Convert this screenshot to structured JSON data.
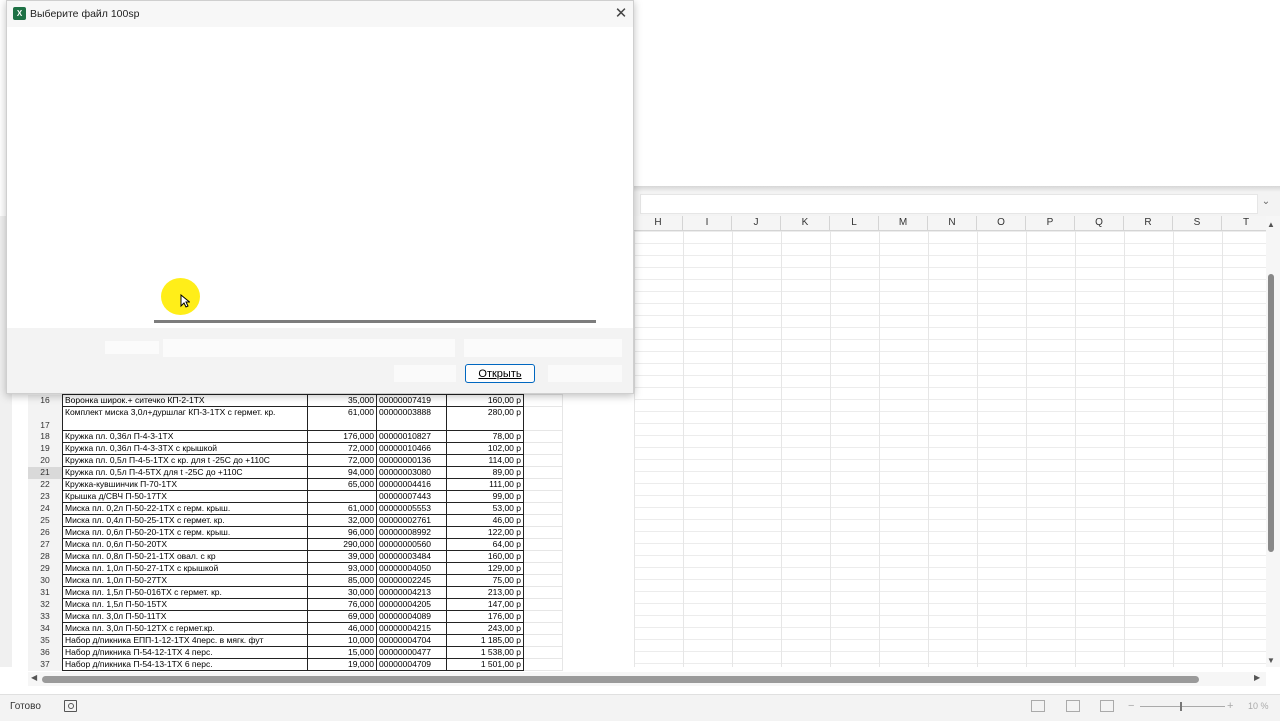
{
  "dialog": {
    "title": "Выберите файл 100sp",
    "app_icon_letter": "X",
    "close_glyph": "✕",
    "open_button_label": "Открыть"
  },
  "columns": [
    "H",
    "I",
    "J",
    "K",
    "L",
    "M",
    "N",
    "O",
    "P",
    "Q",
    "R",
    "S",
    "T"
  ],
  "rows": [
    {
      "num": "16",
      "name": "Воронка широк.+ ситечко КП-2-1ТХ",
      "qty": "35,000",
      "code": "00000007419",
      "price": "160,00 р"
    },
    {
      "num": "17",
      "name": "Комплект миска 3,0л+дуршлаг КП-3-1ТХ с гермет. кр.",
      "qty": "61,000",
      "code": "00000003888",
      "price": "280,00 р"
    },
    {
      "num": "18",
      "name": "Кружка пл. 0,36л П-4-3-1ТХ",
      "qty": "176,000",
      "code": "00000010827",
      "price": "78,00 р"
    },
    {
      "num": "19",
      "name": "Кружка пл. 0,36л П-4-3-3ТХ с крышкой",
      "qty": "72,000",
      "code": "00000010466",
      "price": "102,00 р"
    },
    {
      "num": "20",
      "name": "Кружка пл. 0,5л  П-4-5-1ТХ с кр. для t -25С до +110С",
      "qty": "72,000",
      "code": "00000000136",
      "price": "114,00 р"
    },
    {
      "num": "21",
      "name": "Кружка пл. 0,5л  П-4-5ТХ для t -25С до +110С",
      "qty": "94,000",
      "code": "00000003080",
      "price": "89,00 р"
    },
    {
      "num": "22",
      "name": "Кружка-кувшинчик П-70-1ТХ",
      "qty": "65,000",
      "code": "00000004416",
      "price": "111,00 р"
    },
    {
      "num": "23",
      "name": "Крышка д/СВЧ П-50-17ТХ",
      "qty": "",
      "code": "00000007443",
      "price": "99,00 р"
    },
    {
      "num": "24",
      "name": "Миска пл. 0,2л П-50-22-1ТХ с герм. крыш.",
      "qty": "61,000",
      "code": "00000005553",
      "price": "53,00 р"
    },
    {
      "num": "25",
      "name": "Миска пл. 0,4л П-50-25-1ТХ с гермет. кр.",
      "qty": "32,000",
      "code": "00000002761",
      "price": "46,00 р"
    },
    {
      "num": "26",
      "name": "Миска пл. 0,6л П-50-20-1ТХ с герм. крыш.",
      "qty": "96,000",
      "code": "00000008992",
      "price": "122,00 р"
    },
    {
      "num": "27",
      "name": "Миска пл. 0,6л П-50-20ТХ",
      "qty": "290,000",
      "code": "00000000560",
      "price": "64,00 р"
    },
    {
      "num": "28",
      "name": "Миска пл. 0,8л П-50-21-1ТХ овал. с кр",
      "qty": "39,000",
      "code": "00000003484",
      "price": "160,00 р"
    },
    {
      "num": "29",
      "name": "Миска пл. 1,0л П-50-27-1ТХ с крышкой",
      "qty": "93,000",
      "code": "00000004050",
      "price": "129,00 р"
    },
    {
      "num": "30",
      "name": "Миска пл. 1,0л П-50-27ТХ",
      "qty": "85,000",
      "code": "00000002245",
      "price": "75,00 р"
    },
    {
      "num": "31",
      "name": "Миска пл. 1,5л П-50-016ТХ с гермет. кр.",
      "qty": "30,000",
      "code": "00000004213",
      "price": "213,00 р"
    },
    {
      "num": "32",
      "name": "Миска пл. 1,5л П-50-15ТХ",
      "qty": "76,000",
      "code": "00000004205",
      "price": "147,00 р"
    },
    {
      "num": "33",
      "name": "Миска пл. 3,0л П-50-11ТХ",
      "qty": "69,000",
      "code": "00000004089",
      "price": "176,00 р"
    },
    {
      "num": "34",
      "name": "Миска пл. 3,0л П-50-12ТХ с гермет.кр.",
      "qty": "46,000",
      "code": "00000004215",
      "price": "243,00 р"
    },
    {
      "num": "35",
      "name": "Набор д/пикника ЕПП-1-12-1ТХ 4перс. в мягк. фут",
      "qty": "10,000",
      "code": "00000004704",
      "price": "1 185,00 р"
    },
    {
      "num": "36",
      "name": "Набор д/пикника П-54-12-1ТХ 4 перс.",
      "qty": "15,000",
      "code": "00000000477",
      "price": "1 538,00 р"
    },
    {
      "num": "37",
      "name": "Набор д/пикника П-54-13-1ТХ 6 перс.",
      "qty": "19,000",
      "code": "00000004709",
      "price": "1 501,00 р"
    }
  ],
  "selected_row": "21",
  "status": {
    "ready_text": "Готово",
    "zoom_minus": "−",
    "zoom_plus": "+",
    "zoom_level": "10 %"
  },
  "colors": {
    "excel_green": "#1e7145",
    "accent_blue": "#0067c0",
    "cursor_highlight": "#ffec00"
  },
  "icons": {
    "close": "close-icon",
    "excel": "excel-app-icon",
    "cursor": "mouse-pointer-icon",
    "macro": "macro-record-icon"
  }
}
